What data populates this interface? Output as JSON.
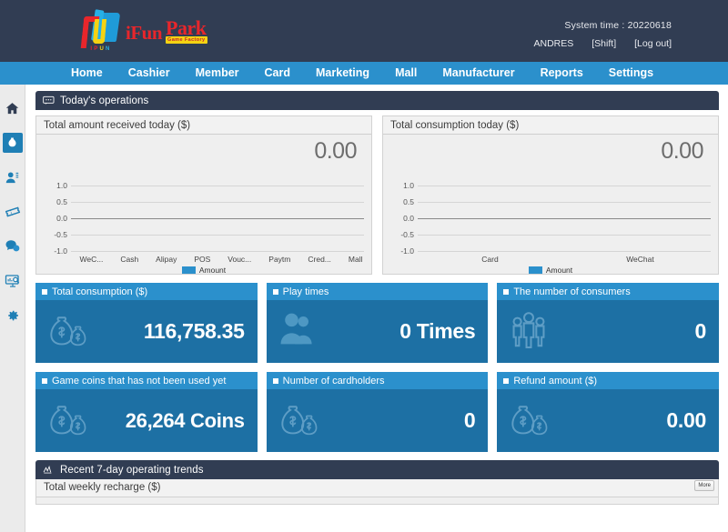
{
  "header": {
    "logo": {
      "brand_primary": "iFun",
      "brand_secondary": "Park",
      "brand_tagline": "Game Factory",
      "mark_sub_i": "I",
      "mark_sub_p": "P",
      "mark_sub_u": "U",
      "mark_sub_n": "N"
    },
    "system_time_label": "System time : 20220618",
    "user": "ANDRES",
    "shift_link": "[Shift]",
    "logout_link": "[Log out]"
  },
  "nav": {
    "items": [
      {
        "label": "Home"
      },
      {
        "label": "Cashier"
      },
      {
        "label": "Member"
      },
      {
        "label": "Card"
      },
      {
        "label": "Marketing"
      },
      {
        "label": "Mall"
      },
      {
        "label": "Manufacturer"
      },
      {
        "label": "Reports"
      },
      {
        "label": "Settings"
      }
    ]
  },
  "sidebar": {
    "items": [
      {
        "icon": "home-icon",
        "selected": false
      },
      {
        "icon": "cashier-bag-icon",
        "selected": true
      },
      {
        "icon": "member-user-icon",
        "selected": false
      },
      {
        "icon": "ticket-card-icon",
        "selected": false
      },
      {
        "icon": "chat-marketing-icon",
        "selected": false
      },
      {
        "icon": "report-monitor-icon",
        "selected": false
      },
      {
        "icon": "gear-settings-icon",
        "selected": false
      }
    ]
  },
  "today": {
    "section_title": "Today's operations",
    "section_icon": "speech-bubble-icon"
  },
  "cards": {
    "items": [
      {
        "title": "Total consumption ($)",
        "value": "116,758.35",
        "icon": "money-bags-icon"
      },
      {
        "title": "Play times",
        "value": "0 Times",
        "icon": "two-people-icon"
      },
      {
        "title": "The number of consumers",
        "value": "0",
        "icon": "group-people-icon"
      },
      {
        "title": "Game coins that has not been used yet",
        "value": "26,264 Coins",
        "icon": "money-bags-icon"
      },
      {
        "title": "Number of cardholders",
        "value": "0",
        "icon": "money-bags-icon"
      },
      {
        "title": "Refund amount ($)",
        "value": "0.00",
        "icon": "money-bags-icon"
      }
    ]
  },
  "trends": {
    "section_title": "Recent 7-day operating trends",
    "section_icon": "line-chart-icon",
    "panel_title": "Total weekly recharge ($)",
    "more_label": "More"
  },
  "colors": {
    "header_bg": "#313d53",
    "nav_bg": "#2b90cc",
    "card_head": "#2b90cc",
    "card_body": "#1d70a4",
    "accent": "#2b90cc",
    "rail_bg": "#ebebeb",
    "chart_bg": "#efefef"
  },
  "chart_data": [
    {
      "type": "bar",
      "title": "Total amount received today ($)",
      "display_value": "0.00",
      "categories": [
        "WeC...",
        "Cash",
        "Alipay",
        "POS",
        "Vouc...",
        "Paytm",
        "Cred...",
        "Mall"
      ],
      "series": [
        {
          "name": "Amount",
          "values": [
            0,
            0,
            0,
            0,
            0,
            0,
            0,
            0
          ],
          "color": "#2b90cc"
        }
      ],
      "yticks": [
        "1.0",
        "0.5",
        "0.0",
        "-0.5",
        "-1.0"
      ],
      "ylim": [
        -1.0,
        1.0
      ],
      "xlabel": "",
      "ylabel": "",
      "grid": true,
      "legend": "bottom-center"
    },
    {
      "type": "bar",
      "title": "Total consumption today ($)",
      "display_value": "0.00",
      "categories": [
        "Card",
        "WeChat"
      ],
      "series": [
        {
          "name": "Amount",
          "values": [
            0,
            0
          ],
          "color": "#2b90cc"
        }
      ],
      "yticks": [
        "1.0",
        "0.5",
        "0.0",
        "-0.5",
        "-1.0"
      ],
      "ylim": [
        -1.0,
        1.0
      ],
      "xlabel": "",
      "ylabel": "",
      "grid": true,
      "legend": "bottom-center"
    }
  ]
}
